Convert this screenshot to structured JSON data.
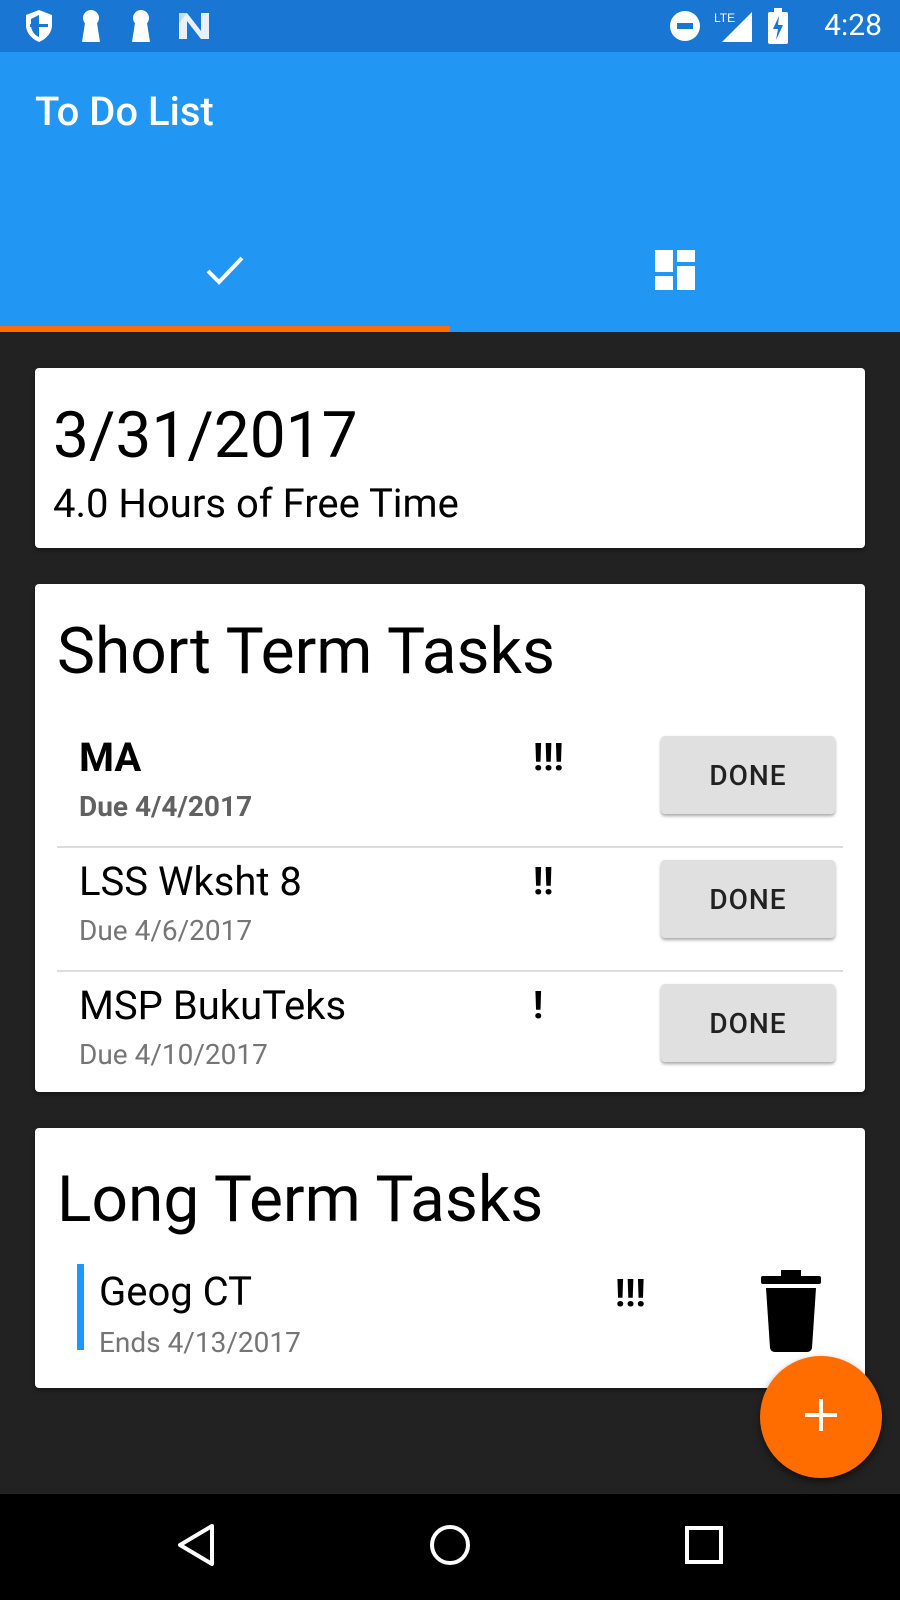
{
  "status_bar": {
    "time": "4:28",
    "network": "LTE",
    "icons": [
      "shield-icon",
      "keyhole-icon",
      "keyhole-icon",
      "n-icon",
      "do-not-disturb-icon",
      "signal-icon",
      "battery-charging-icon"
    ]
  },
  "app_bar": {
    "title": "To Do List",
    "tabs": [
      {
        "icon": "check-icon",
        "selected": true
      },
      {
        "icon": "dashboard-icon",
        "selected": false
      }
    ],
    "accent_color": "#FF6D00",
    "primary_color": "#2196F3"
  },
  "summary": {
    "date": "3/31/2017",
    "free_time": "4.0 Hours of Free Time"
  },
  "short_term": {
    "title": "Short Term Tasks",
    "tasks": [
      {
        "name": "MA",
        "due": "Due 4/4/2017",
        "priority": "!!!",
        "button": "DONE"
      },
      {
        "name": "LSS Wksht 8",
        "due": "Due 4/6/2017",
        "priority": "!!",
        "button": "DONE"
      },
      {
        "name": "MSP BukuTeks",
        "due": "Due 4/10/2017",
        "priority": "!",
        "button": "DONE"
      }
    ]
  },
  "long_term": {
    "title": "Long Term Tasks",
    "tasks": [
      {
        "name": "Geog CT",
        "ends": "Ends 4/13/2017",
        "priority": "!!!",
        "action_icon": "trash-icon"
      }
    ]
  },
  "fab": {
    "icon": "plus-icon"
  },
  "nav_bar": {
    "buttons": [
      "back-icon",
      "home-icon",
      "recents-icon"
    ]
  }
}
